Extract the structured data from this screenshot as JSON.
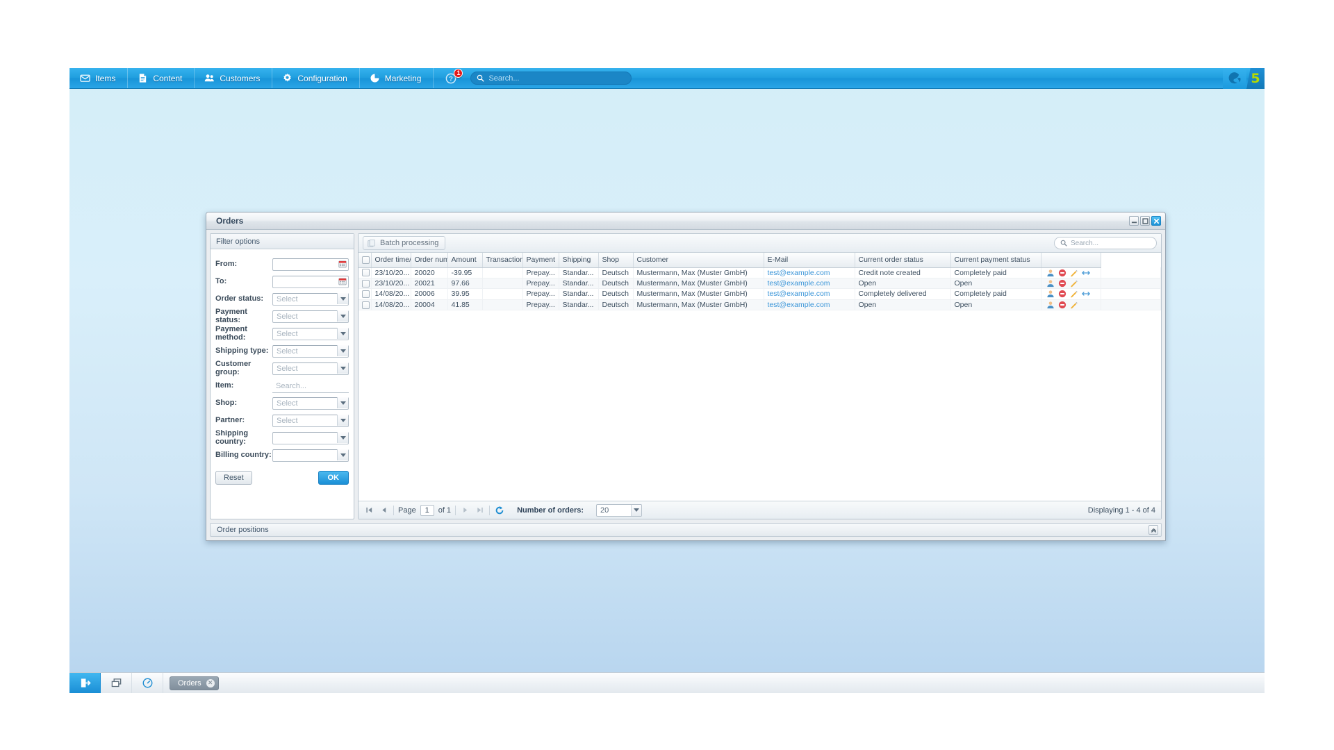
{
  "topbar": {
    "nav": [
      {
        "label": "Items",
        "icon": "mail-icon"
      },
      {
        "label": "Content",
        "icon": "document-icon"
      },
      {
        "label": "Customers",
        "icon": "users-icon"
      },
      {
        "label": "Configuration",
        "icon": "gear-icon"
      },
      {
        "label": "Marketing",
        "icon": "pie-chart-icon"
      }
    ],
    "help_icon": "help-icon",
    "help_badge": "1",
    "search_placeholder": "Search...",
    "search_value": "",
    "logo_icon": "shopware-swirl-icon",
    "logo_version": "5",
    "accent_color": "#1f9ede"
  },
  "window": {
    "title": "Orders",
    "minimize_label": "–",
    "maximize_label": "□",
    "close_label": "✖"
  },
  "filter": {
    "header": "Filter options",
    "fields": [
      {
        "label": "From:",
        "type": "date",
        "value": "",
        "placeholder": "",
        "icon": "calendar-icon"
      },
      {
        "label": "To:",
        "type": "date",
        "value": "",
        "placeholder": "",
        "icon": "calendar-icon"
      },
      {
        "label": "Order status:",
        "type": "select",
        "value": "",
        "placeholder": "Select"
      },
      {
        "label": "Payment status:",
        "type": "select",
        "value": "",
        "placeholder": "Select"
      },
      {
        "label": "Payment method:",
        "type": "select",
        "value": "",
        "placeholder": "Select"
      },
      {
        "label": "Shipping type:",
        "type": "select",
        "value": "",
        "placeholder": "Select"
      },
      {
        "label": "Customer group:",
        "type": "select",
        "value": "",
        "placeholder": "Select"
      },
      {
        "label": "Item:",
        "type": "search",
        "value": "",
        "placeholder": "Search..."
      },
      {
        "label": "Shop:",
        "type": "select",
        "value": "",
        "placeholder": "Select"
      },
      {
        "label": "Partner:",
        "type": "select",
        "value": "",
        "placeholder": "Select"
      },
      {
        "label": "Shipping country:",
        "type": "select",
        "value": "",
        "placeholder": ""
      },
      {
        "label": "Billing country:",
        "type": "select",
        "value": "",
        "placeholder": ""
      }
    ],
    "reset_label": "Reset",
    "ok_label": "OK"
  },
  "grid": {
    "batch_label": "Batch processing",
    "batch_icon": "batch-icon",
    "search_placeholder": "Search...",
    "search_value": "",
    "columns": [
      "Order time/d",
      "Order numb",
      "Amount",
      "Transaction",
      "Payment",
      "Shipping",
      "Shop",
      "Customer",
      "E-Mail",
      "Current order status",
      "Current payment status",
      ""
    ],
    "rows": [
      {
        "order_time": "23/10/20...",
        "order_number": "20020",
        "amount": "-39.95",
        "transaction": "",
        "payment": "Prepay...",
        "shipping": "Standar...",
        "shop": "Deutsch",
        "customer": "Mustermann, Max (Muster GmbH)",
        "email": "test@example.com",
        "order_status": "Credit note created",
        "payment_status": "Completely paid",
        "actions": [
          "customer-icon",
          "delete-icon",
          "edit-icon",
          "transfer-icon"
        ]
      },
      {
        "order_time": "23/10/20...",
        "order_number": "20021",
        "amount": "97.66",
        "transaction": "",
        "payment": "Prepay...",
        "shipping": "Standar...",
        "shop": "Deutsch",
        "customer": "Mustermann, Max (Muster GmbH)",
        "email": "test@example.com",
        "order_status": "Open",
        "payment_status": "Open",
        "actions": [
          "customer-icon",
          "delete-icon",
          "edit-icon"
        ]
      },
      {
        "order_time": "14/08/20...",
        "order_number": "20006",
        "amount": "39.95",
        "transaction": "",
        "payment": "Prepay...",
        "shipping": "Standar...",
        "shop": "Deutsch",
        "customer": "Mustermann, Max (Muster GmbH)",
        "email": "test@example.com",
        "order_status": "Completely delivered",
        "payment_status": "Completely paid",
        "actions": [
          "customer-icon",
          "delete-icon",
          "edit-icon",
          "transfer-icon"
        ]
      },
      {
        "order_time": "14/08/20...",
        "order_number": "20004",
        "amount": "41.85",
        "transaction": "",
        "payment": "Prepay...",
        "shipping": "Standar...",
        "shop": "Deutsch",
        "customer": "Mustermann, Max (Muster GmbH)",
        "email": "test@example.com",
        "order_status": "Open",
        "payment_status": "Open",
        "actions": [
          "customer-icon",
          "delete-icon",
          "edit-icon"
        ]
      }
    ]
  },
  "pager": {
    "first_icon": "first-page-icon",
    "prev_icon": "prev-page-icon",
    "page_label": "Page",
    "page_value": "1",
    "of_label": "of 1",
    "next_icon": "next-page-icon",
    "last_icon": "last-page-icon",
    "refresh_icon": "refresh-icon",
    "number_of_orders_label": "Number of orders:",
    "number_of_orders_value": "20",
    "displaying": "Displaying 1 - 4 of 4"
  },
  "order_positions": {
    "title": "Order positions",
    "collapse_icon": "collapse-icon"
  },
  "taskbar": {
    "buttons": [
      {
        "icon": "logout-icon",
        "active": true
      },
      {
        "icon": "windows-icon",
        "active": false
      },
      {
        "icon": "dashboard-icon",
        "active": false
      }
    ],
    "task_label": "Orders",
    "task_close": "✕"
  }
}
